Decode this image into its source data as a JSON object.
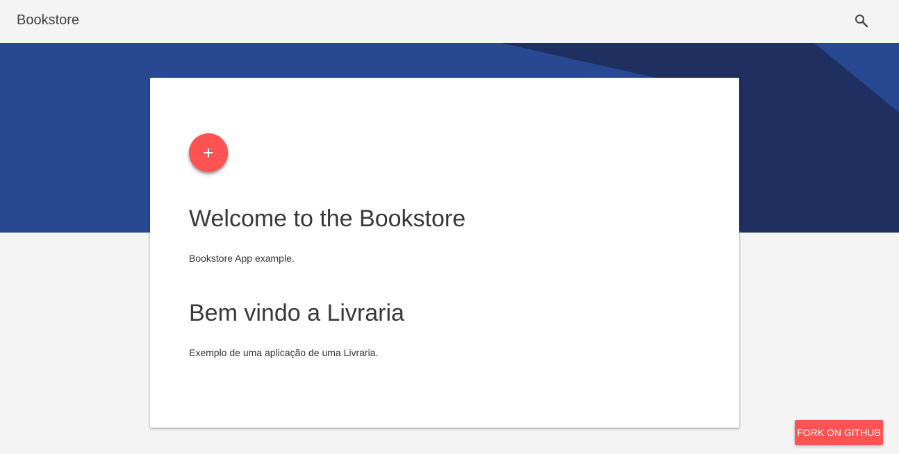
{
  "header": {
    "title": "Bookstore",
    "search_icon": "search-icon"
  },
  "hero": {
    "colors": {
      "primary": "#284892",
      "dark": "#1e2f60"
    }
  },
  "card": {
    "add_button_icon": "plus-icon",
    "sections": [
      {
        "heading": "Welcome to the Bookstore",
        "text": "Bookstore App example."
      },
      {
        "heading": "Bem vindo a Livraria",
        "text": "Exemplo de uma aplicação de uma Livraria."
      }
    ]
  },
  "fork_button": {
    "label": "FORK ON GITHUB"
  },
  "colors": {
    "accent": "#ff5252",
    "background": "#f4f4f4"
  }
}
